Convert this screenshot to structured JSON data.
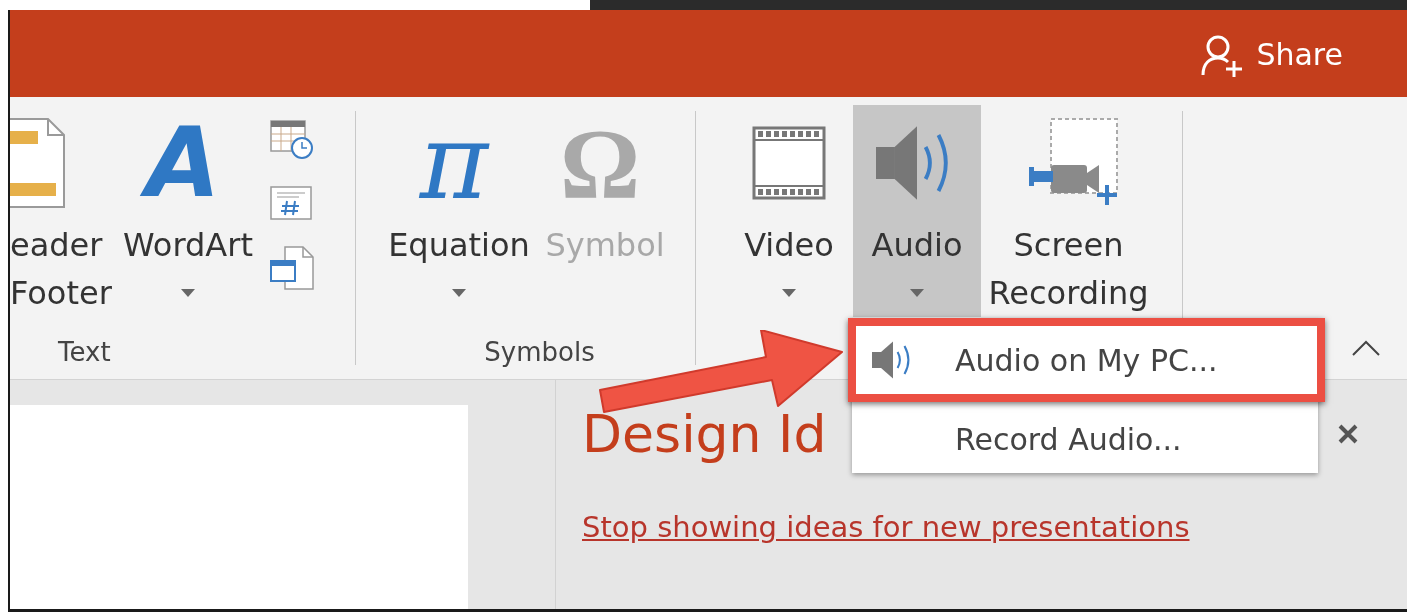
{
  "title_bar": {
    "share_label": "Share"
  },
  "ribbon": {
    "groups": [
      {
        "label": "Text",
        "commands": [
          {
            "kind": "headerfooter",
            "lines": [
              "eader",
              "Footer"
            ],
            "dropdown": false,
            "disabled": false,
            "pressed": false
          },
          {
            "kind": "wordart",
            "glyph": "A",
            "lines": [
              "WordArt"
            ],
            "dropdown": true,
            "disabled": false,
            "pressed": false
          },
          {
            "kind": "iconstack"
          }
        ]
      },
      {
        "label": "Symbols",
        "commands": [
          {
            "kind": "equation",
            "glyph": "π",
            "lines": [
              "Equation"
            ],
            "dropdown": true,
            "disabled": false,
            "pressed": false
          },
          {
            "kind": "symbol",
            "glyph": "Ω",
            "lines": [
              "Symbol"
            ],
            "dropdown": false,
            "disabled": true,
            "pressed": false
          }
        ]
      },
      {
        "commands": [
          {
            "kind": "video",
            "lines": [
              "Video"
            ],
            "dropdown": true,
            "disabled": false,
            "pressed": false
          },
          {
            "kind": "audio",
            "lines": [
              "Audio"
            ],
            "dropdown": true,
            "disabled": false,
            "pressed": true
          },
          {
            "kind": "screenrecording",
            "lines": [
              "Screen",
              "Recording"
            ],
            "dropdown": false,
            "disabled": false,
            "pressed": false
          }
        ]
      }
    ]
  },
  "audio_menu": {
    "items": [
      {
        "label": "Audio on My PC...",
        "kind": "speaker",
        "highlighted": true
      },
      {
        "label": "Record Audio...",
        "kind": "plain",
        "highlighted": false
      }
    ]
  },
  "design_ideas": {
    "title": "Design Id",
    "link": "Stop showing ideas for new presentations"
  }
}
